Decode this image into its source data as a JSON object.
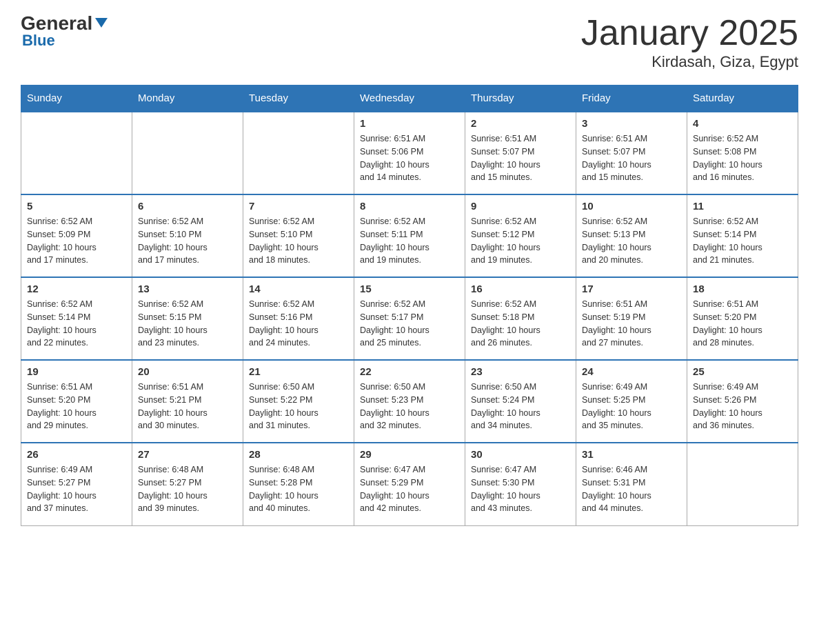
{
  "header": {
    "logo_general": "General",
    "logo_blue": "Blue",
    "title": "January 2025",
    "subtitle": "Kirdasah, Giza, Egypt"
  },
  "days_of_week": [
    "Sunday",
    "Monday",
    "Tuesday",
    "Wednesday",
    "Thursday",
    "Friday",
    "Saturday"
  ],
  "weeks": [
    [
      {
        "day": "",
        "info": ""
      },
      {
        "day": "",
        "info": ""
      },
      {
        "day": "",
        "info": ""
      },
      {
        "day": "1",
        "info": "Sunrise: 6:51 AM\nSunset: 5:06 PM\nDaylight: 10 hours\nand 14 minutes."
      },
      {
        "day": "2",
        "info": "Sunrise: 6:51 AM\nSunset: 5:07 PM\nDaylight: 10 hours\nand 15 minutes."
      },
      {
        "day": "3",
        "info": "Sunrise: 6:51 AM\nSunset: 5:07 PM\nDaylight: 10 hours\nand 15 minutes."
      },
      {
        "day": "4",
        "info": "Sunrise: 6:52 AM\nSunset: 5:08 PM\nDaylight: 10 hours\nand 16 minutes."
      }
    ],
    [
      {
        "day": "5",
        "info": "Sunrise: 6:52 AM\nSunset: 5:09 PM\nDaylight: 10 hours\nand 17 minutes."
      },
      {
        "day": "6",
        "info": "Sunrise: 6:52 AM\nSunset: 5:10 PM\nDaylight: 10 hours\nand 17 minutes."
      },
      {
        "day": "7",
        "info": "Sunrise: 6:52 AM\nSunset: 5:10 PM\nDaylight: 10 hours\nand 18 minutes."
      },
      {
        "day": "8",
        "info": "Sunrise: 6:52 AM\nSunset: 5:11 PM\nDaylight: 10 hours\nand 19 minutes."
      },
      {
        "day": "9",
        "info": "Sunrise: 6:52 AM\nSunset: 5:12 PM\nDaylight: 10 hours\nand 19 minutes."
      },
      {
        "day": "10",
        "info": "Sunrise: 6:52 AM\nSunset: 5:13 PM\nDaylight: 10 hours\nand 20 minutes."
      },
      {
        "day": "11",
        "info": "Sunrise: 6:52 AM\nSunset: 5:14 PM\nDaylight: 10 hours\nand 21 minutes."
      }
    ],
    [
      {
        "day": "12",
        "info": "Sunrise: 6:52 AM\nSunset: 5:14 PM\nDaylight: 10 hours\nand 22 minutes."
      },
      {
        "day": "13",
        "info": "Sunrise: 6:52 AM\nSunset: 5:15 PM\nDaylight: 10 hours\nand 23 minutes."
      },
      {
        "day": "14",
        "info": "Sunrise: 6:52 AM\nSunset: 5:16 PM\nDaylight: 10 hours\nand 24 minutes."
      },
      {
        "day": "15",
        "info": "Sunrise: 6:52 AM\nSunset: 5:17 PM\nDaylight: 10 hours\nand 25 minutes."
      },
      {
        "day": "16",
        "info": "Sunrise: 6:52 AM\nSunset: 5:18 PM\nDaylight: 10 hours\nand 26 minutes."
      },
      {
        "day": "17",
        "info": "Sunrise: 6:51 AM\nSunset: 5:19 PM\nDaylight: 10 hours\nand 27 minutes."
      },
      {
        "day": "18",
        "info": "Sunrise: 6:51 AM\nSunset: 5:20 PM\nDaylight: 10 hours\nand 28 minutes."
      }
    ],
    [
      {
        "day": "19",
        "info": "Sunrise: 6:51 AM\nSunset: 5:20 PM\nDaylight: 10 hours\nand 29 minutes."
      },
      {
        "day": "20",
        "info": "Sunrise: 6:51 AM\nSunset: 5:21 PM\nDaylight: 10 hours\nand 30 minutes."
      },
      {
        "day": "21",
        "info": "Sunrise: 6:50 AM\nSunset: 5:22 PM\nDaylight: 10 hours\nand 31 minutes."
      },
      {
        "day": "22",
        "info": "Sunrise: 6:50 AM\nSunset: 5:23 PM\nDaylight: 10 hours\nand 32 minutes."
      },
      {
        "day": "23",
        "info": "Sunrise: 6:50 AM\nSunset: 5:24 PM\nDaylight: 10 hours\nand 34 minutes."
      },
      {
        "day": "24",
        "info": "Sunrise: 6:49 AM\nSunset: 5:25 PM\nDaylight: 10 hours\nand 35 minutes."
      },
      {
        "day": "25",
        "info": "Sunrise: 6:49 AM\nSunset: 5:26 PM\nDaylight: 10 hours\nand 36 minutes."
      }
    ],
    [
      {
        "day": "26",
        "info": "Sunrise: 6:49 AM\nSunset: 5:27 PM\nDaylight: 10 hours\nand 37 minutes."
      },
      {
        "day": "27",
        "info": "Sunrise: 6:48 AM\nSunset: 5:27 PM\nDaylight: 10 hours\nand 39 minutes."
      },
      {
        "day": "28",
        "info": "Sunrise: 6:48 AM\nSunset: 5:28 PM\nDaylight: 10 hours\nand 40 minutes."
      },
      {
        "day": "29",
        "info": "Sunrise: 6:47 AM\nSunset: 5:29 PM\nDaylight: 10 hours\nand 42 minutes."
      },
      {
        "day": "30",
        "info": "Sunrise: 6:47 AM\nSunset: 5:30 PM\nDaylight: 10 hours\nand 43 minutes."
      },
      {
        "day": "31",
        "info": "Sunrise: 6:46 AM\nSunset: 5:31 PM\nDaylight: 10 hours\nand 44 minutes."
      },
      {
        "day": "",
        "info": ""
      }
    ]
  ]
}
